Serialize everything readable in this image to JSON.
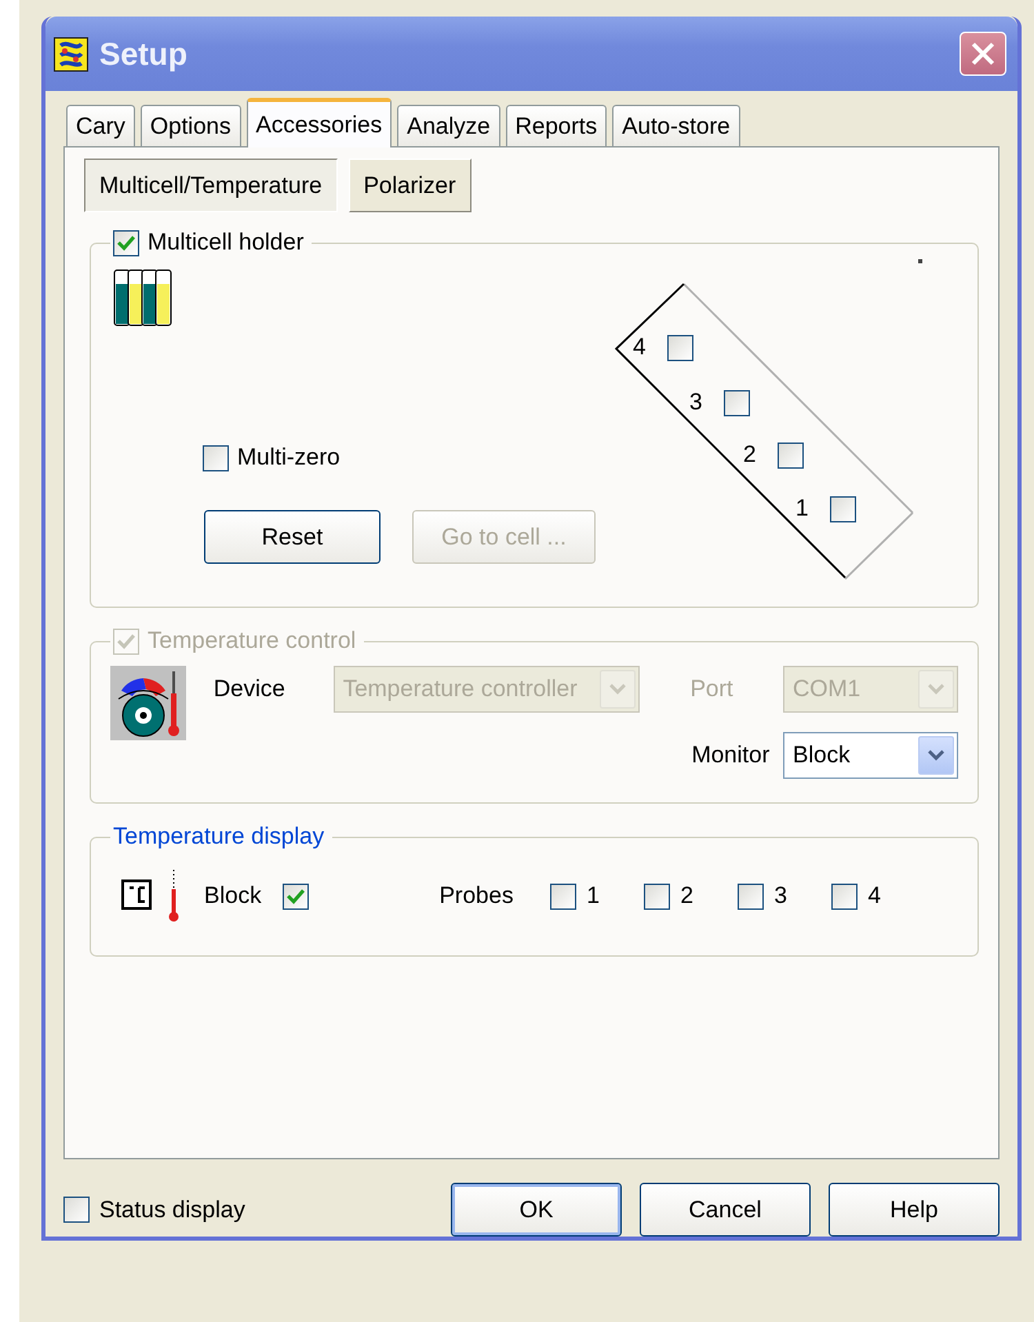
{
  "window": {
    "title": "Setup"
  },
  "tabs": [
    {
      "label": "Cary",
      "selected": false
    },
    {
      "label": "Options",
      "selected": false
    },
    {
      "label": "Accessories",
      "selected": true
    },
    {
      "label": "Analyze",
      "selected": false
    },
    {
      "label": "Reports",
      "selected": false
    },
    {
      "label": "Auto-store",
      "selected": false
    }
  ],
  "subtabs": [
    {
      "label": "Multicell/Temperature",
      "selected": true
    },
    {
      "label": "Polarizer",
      "selected": false
    }
  ],
  "multicell": {
    "label": "Multicell holder",
    "checked": true,
    "multi_zero": {
      "label": "Multi-zero",
      "checked": false
    },
    "cells": [
      {
        "label": "4",
        "checked": false
      },
      {
        "label": "3",
        "checked": false
      },
      {
        "label": "2",
        "checked": false
      },
      {
        "label": "1",
        "checked": false
      }
    ],
    "buttons": [
      {
        "label": "Reset",
        "disabled": false
      },
      {
        "label": "Go to cell ...",
        "disabled": true
      }
    ]
  },
  "temperature_control": {
    "label": "Temperature control",
    "checked": true,
    "disabled": true,
    "device": {
      "label": "Device",
      "value": "Temperature controller",
      "disabled": true
    },
    "port": {
      "label": "Port",
      "value": "COM1",
      "disabled": true
    },
    "monitor": {
      "label": "Monitor",
      "value": "Block",
      "disabled": false
    }
  },
  "temperature_display": {
    "label": "Temperature display",
    "block": {
      "label": "Block",
      "checked": true
    },
    "probes": {
      "label": "Probes",
      "items": [
        {
          "label": "1",
          "checked": false
        },
        {
          "label": "2",
          "checked": false
        },
        {
          "label": "3",
          "checked": false
        },
        {
          "label": "4",
          "checked": false
        }
      ]
    }
  },
  "status_display": {
    "label": "Status display",
    "checked": false
  },
  "buttons": [
    {
      "label": "OK",
      "default": true
    },
    {
      "label": "Cancel",
      "default": false
    },
    {
      "label": "Help",
      "default": false
    }
  ]
}
